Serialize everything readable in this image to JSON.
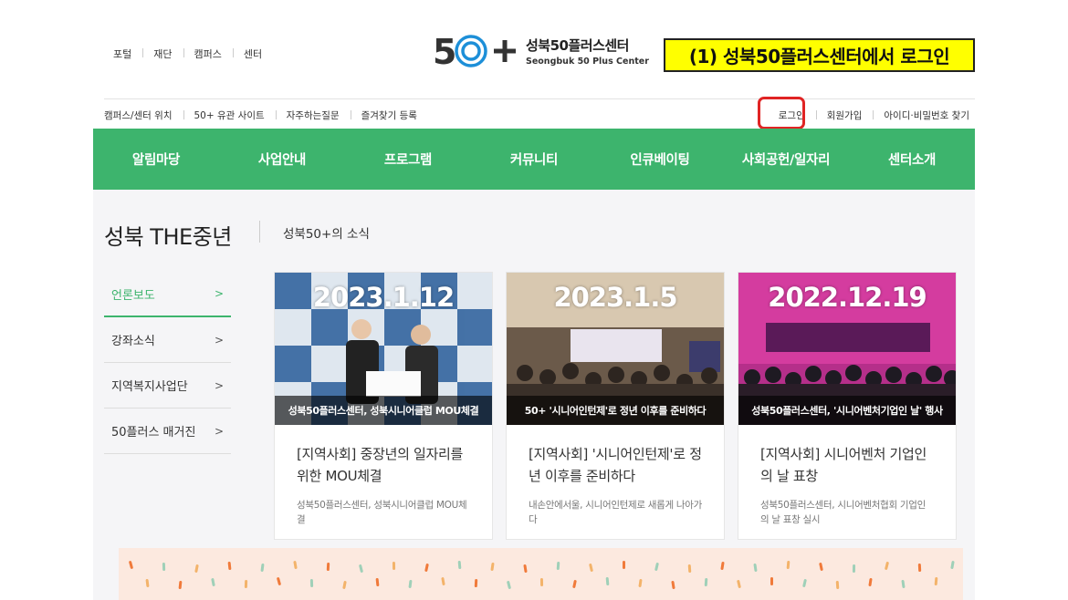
{
  "portal_links": [
    "포털",
    "재단",
    "캠퍼스",
    "센터"
  ],
  "logo": {
    "mark": "50+",
    "name_kr": "성북50플러스센터",
    "name_en": "Seongbuk 50 Plus Center",
    "accent": "#1d8fd8"
  },
  "annotation": "(1) 성북50플러스센터에서 로그인",
  "util_left": [
    "캠퍼스/센터 위치",
    "50+ 유관 사이트",
    "자주하는질문",
    "즐겨찾기 등록"
  ],
  "util_right": {
    "login": "로그인",
    "signup": "회원가입",
    "find": "아이디·비밀번호 찾기"
  },
  "nav": [
    "알림마당",
    "사업안내",
    "프로그램",
    "커뮤니티",
    "인큐베이팅",
    "사회공헌/일자리",
    "센터소개"
  ],
  "page": {
    "title": "성북 THE중년",
    "subtitle": "성북50+의 소식"
  },
  "side_menu": [
    {
      "label": "언론보도",
      "chevron": ">"
    },
    {
      "label": "강좌소식",
      "chevron": ">"
    },
    {
      "label": "지역복지사업단",
      "chevron": ">"
    },
    {
      "label": "50플러스 매거진",
      "chevron": ">"
    }
  ],
  "cards": [
    {
      "date": "2023.1.12",
      "caption": "성북50플러스센터, 성북시니어클럽 MOU체결",
      "title": "[지역사회] 중장년의 일자리를 위한 MOU체결",
      "desc": "성북50플러스센터, 성북시니어클럽 MOU체결"
    },
    {
      "date": "2023.1.5",
      "caption": "50+ '시니어인턴제'로 정년 이후를 준비하다",
      "title": "[지역사회] '시니어인턴제'로 정년 이후를 준비하다",
      "desc": "내손안에서울, 시니어인턴제로 새롭게 나아가다"
    },
    {
      "date": "2022.12.19",
      "caption": "성북50플러스센터, '시니어벤처기업인 날' 행사",
      "title": "[지역사회] 시니어벤처 기업인의 날 표창",
      "desc": "성북50플러스센터, 시니어벤처협회 기업인의 날 표창 실시"
    }
  ],
  "colors": {
    "green": "#3db46d",
    "highlight": "#e02424",
    "annotation_bg": "#ffff00"
  }
}
